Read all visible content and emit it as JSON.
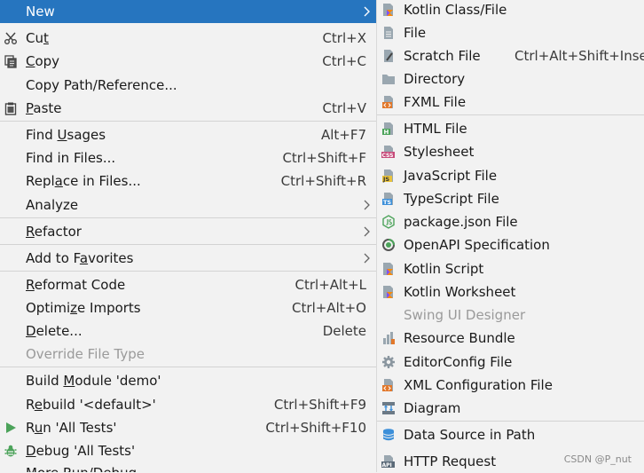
{
  "left_menu": {
    "new": {
      "label": "New",
      "icon": "none"
    },
    "cut": {
      "pre": "Cu",
      "u": "t",
      "post": "",
      "shortcut": "Ctrl+X",
      "icon": "scissors-icon"
    },
    "copy": {
      "pre": "",
      "u": "C",
      "post": "opy",
      "shortcut": "Ctrl+C",
      "icon": "copy-icon"
    },
    "copy_path": {
      "label": "Copy Path/Reference..."
    },
    "paste": {
      "pre": "",
      "u": "P",
      "post": "aste",
      "shortcut": "Ctrl+V",
      "icon": "clipboard-icon"
    },
    "find_usages": {
      "pre": "Find ",
      "u": "U",
      "post": "sages",
      "shortcut": "Alt+F7"
    },
    "find_in_files": {
      "label": "Find in Files...",
      "shortcut": "Ctrl+Shift+F"
    },
    "replace_in_files": {
      "pre": "Repl",
      "u": "a",
      "post": "ce in Files...",
      "shortcut": "Ctrl+Shift+R"
    },
    "analyze": {
      "label": "Analyze"
    },
    "refactor": {
      "pre": "",
      "u": "R",
      "post": "efactor"
    },
    "add_to_favorites": {
      "pre": "Add to F",
      "u": "a",
      "post": "vorites"
    },
    "reformat_code": {
      "pre": "",
      "u": "R",
      "post": "eformat Code",
      "shortcut": "Ctrl+Alt+L"
    },
    "optimize_imports": {
      "pre": "Optimi",
      "u": "z",
      "post": "e Imports",
      "shortcut": "Ctrl+Alt+O"
    },
    "delete": {
      "pre": "",
      "u": "D",
      "post": "elete...",
      "shortcut": "Delete"
    },
    "override_file_type": {
      "label": "Override File Type"
    },
    "build_module": {
      "pre": "Build ",
      "u": "M",
      "post": "odule 'demo'"
    },
    "rebuild": {
      "pre": "R",
      "u": "e",
      "post": "build '<default>'",
      "shortcut": "Ctrl+Shift+F9"
    },
    "run": {
      "pre": "R",
      "u": "u",
      "post": "n 'All Tests'",
      "shortcut": "Ctrl+Shift+F10",
      "icon": "run-icon"
    },
    "debug": {
      "pre": "",
      "u": "D",
      "post": "ebug 'All Tests'",
      "icon": "debug-icon"
    },
    "more_partial": {
      "label": "More Run/Debug"
    }
  },
  "right_menu": {
    "items": [
      {
        "label": "Kotlin Class/File",
        "icon": "kotlin-file-icon"
      },
      {
        "label": "File",
        "icon": "file-icon"
      },
      {
        "label": "Scratch File",
        "shortcut": "Ctrl+Alt+Shift+Insert",
        "icon": "scratch-file-icon"
      },
      {
        "label": "Directory",
        "icon": "folder-icon"
      },
      {
        "label": "FXML File",
        "icon": "fxml-file-icon"
      },
      {
        "label": "HTML File",
        "icon": "html-file-icon"
      },
      {
        "label": "Stylesheet",
        "icon": "css-file-icon"
      },
      {
        "label": "JavaScript File",
        "icon": "javascript-file-icon"
      },
      {
        "label": "TypeScript File",
        "icon": "typescript-file-icon"
      },
      {
        "label": "package.json File",
        "icon": "nodejs-icon"
      },
      {
        "label": "OpenAPI Specification",
        "icon": "openapi-icon"
      },
      {
        "label": "Kotlin Script",
        "icon": "kotlin-script-icon"
      },
      {
        "label": "Kotlin Worksheet",
        "icon": "kotlin-worksheet-icon"
      },
      {
        "label": "Swing UI Designer",
        "icon": "none"
      },
      {
        "label": "Resource Bundle",
        "icon": "resource-bundle-icon"
      },
      {
        "label": "EditorConfig File",
        "icon": "gear-icon"
      },
      {
        "label": "XML Configuration File",
        "icon": "xml-file-icon"
      },
      {
        "label": "Diagram",
        "icon": "diagram-icon"
      },
      {
        "label": "Data Source in Path",
        "icon": "database-icon"
      },
      {
        "label": "HTTP Request",
        "icon": "api-icon"
      }
    ]
  },
  "icon_badges": {
    "html": "H",
    "css": "CSS",
    "js": "JS",
    "ts": "TS",
    "api": "API",
    "xml": "<>"
  },
  "watermark": "CSDN @P_nut",
  "colors": {
    "selected": "#2675bf",
    "background": "#f2f2f2",
    "disabled": "#9a9a9a",
    "separator": "#d3d3d3"
  }
}
